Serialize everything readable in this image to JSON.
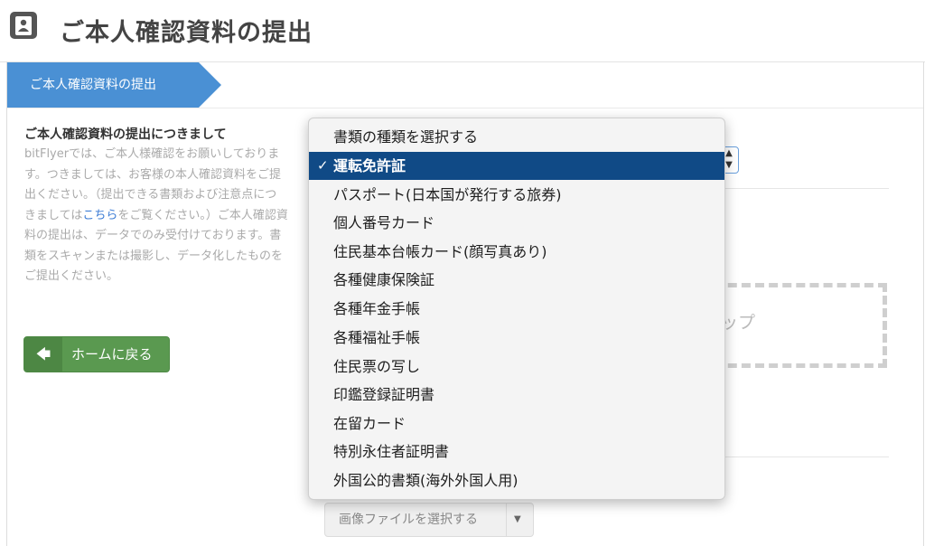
{
  "header": {
    "title": "ご本人確認資料の提出",
    "icon": "id-card-icon"
  },
  "breadcrumb": {
    "label": "ご本人確認資料の提出"
  },
  "info": {
    "title": "ご本人確認資料の提出につきまして",
    "body_before_link": "bitFlyerでは、ご本人様確認をお願いしております。つきましては、お客様の本人確認資料をご提出ください。（提出できる書類および注意点につきましては",
    "link_text": "こちら",
    "body_after_link": "をご覧ください。）ご本人確認資料の提出は、データでのみ受付けております。書類をスキャンまたは撮影し、データ化したものをご提出ください。"
  },
  "home_button": {
    "label": "ホームに戻る",
    "icon": "arrow-left-icon"
  },
  "dropzone": {
    "text_fragment": "ップ"
  },
  "file_button": {
    "label": "画像ファイルを選択する"
  },
  "document_select": {
    "selected": "運転免許証",
    "options": [
      "書類の種類を選択する",
      "運転免許証",
      "パスポート(日本国が発行する旅券)",
      "個人番号カード",
      "住民基本台帳カード(顔写真あり)",
      "各種健康保険証",
      "各種年金手帳",
      "各種福祉手帳",
      "住民票の写し",
      "印鑑登録証明書",
      "在留カード",
      "特別永住者証明書",
      "外国公的書類(海外外国人用)"
    ]
  },
  "colors": {
    "accent": "#4a90d4",
    "home_button": "#5a9950",
    "selected_option": "#104a86"
  }
}
